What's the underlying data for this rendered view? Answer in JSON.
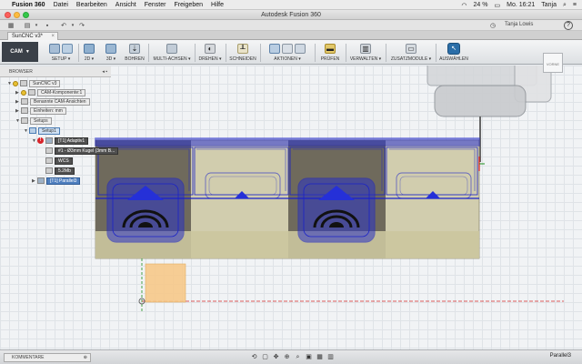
{
  "menubar": {
    "app": "Fusion 360",
    "items": [
      "Datei",
      "Bearbeiten",
      "Ansicht",
      "Fenster",
      "Freigeben",
      "Hilfe"
    ],
    "battery": "24 %",
    "clock": "Mo. 16:21",
    "user": "Tanja"
  },
  "window": {
    "title": "Autodesk Fusion 360"
  },
  "qat": {
    "user": "Tanja Lowis"
  },
  "document": {
    "tab": "SunCNC v3*"
  },
  "ribbon": {
    "workspace": "CAM",
    "groups": [
      {
        "label": "SETUP ▾"
      },
      {
        "label": "2D ▾"
      },
      {
        "label": "3D ▾"
      },
      {
        "label": "BOHREN"
      },
      {
        "label": "MULTI-ACHSEN ▾"
      },
      {
        "label": "DREHEN ▾"
      },
      {
        "label": "SCHNEIDEN"
      },
      {
        "label": "AKTIONEN ▾"
      },
      {
        "label": "PRÜFEN"
      },
      {
        "label": "VERWALTEN ▾"
      },
      {
        "label": "ZUSATZMODULE ▾"
      },
      {
        "label": "AUSWÄHLEN"
      }
    ]
  },
  "browser": {
    "title": "BROWSER",
    "items": [
      {
        "label": "SunCNC v3"
      },
      {
        "label": "CAM-Komponente:1"
      },
      {
        "label": "Benannte CAM-Ansichten"
      },
      {
        "label": "Einheiten: mm"
      },
      {
        "label": "Setups"
      },
      {
        "label": "Setup1"
      },
      {
        "label": "[T1] Adaptiv1"
      },
      {
        "label": "#1 - Ø3mm Kugel (3mm B..."
      },
      {
        "label": "WCS"
      },
      {
        "label": "5.2Mb"
      },
      {
        "label": "[T1] Parallel3"
      }
    ]
  },
  "viewcube": {
    "label": "VORNE"
  },
  "bottom": {
    "comments": "KOMMENTARE",
    "status": "Parallel3"
  },
  "colors": {
    "toolpath": "#1a22c8",
    "stock": "#cfcbaa",
    "part_dark": "#6f6a5c",
    "workspace_bg": "#3a4048",
    "active": "#2b6ea8"
  }
}
